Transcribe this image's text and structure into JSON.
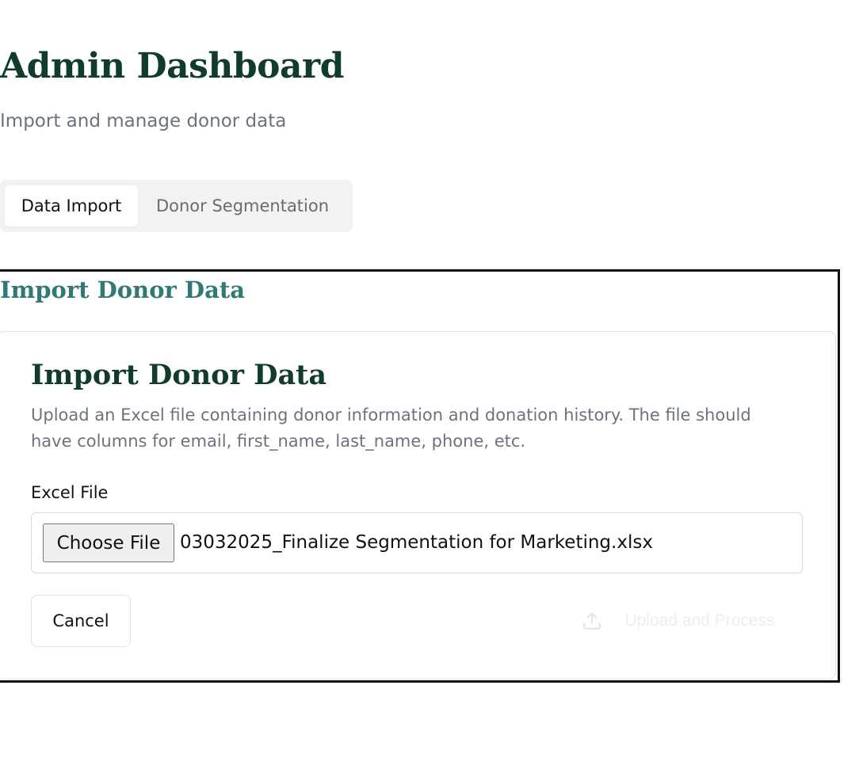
{
  "header": {
    "title": "Admin Dashboard",
    "subtitle": "Import and manage donor data"
  },
  "tabs": [
    {
      "label": "Data Import",
      "active": true
    },
    {
      "label": "Donor Segmentation",
      "active": false
    }
  ],
  "section": {
    "title": "Import Donor Data"
  },
  "card": {
    "title": "Import Donor Data",
    "description": "Upload an Excel file containing donor information and donation history. The file should have columns for email, first_name, last_name, phone, etc.",
    "field_label": "Excel File",
    "choose_file_label": "Choose File",
    "selected_file": "03032025_Finalize Segmentation for Marketing.xlsx",
    "cancel_label": "Cancel",
    "upload_label": "Upload and Process",
    "upload_icon": "upload-icon"
  },
  "colors": {
    "heading": "#0f3d2a",
    "section_heading": "#2d7a76",
    "muted_text": "#6b7280",
    "tab_background": "#f3f2f0"
  }
}
